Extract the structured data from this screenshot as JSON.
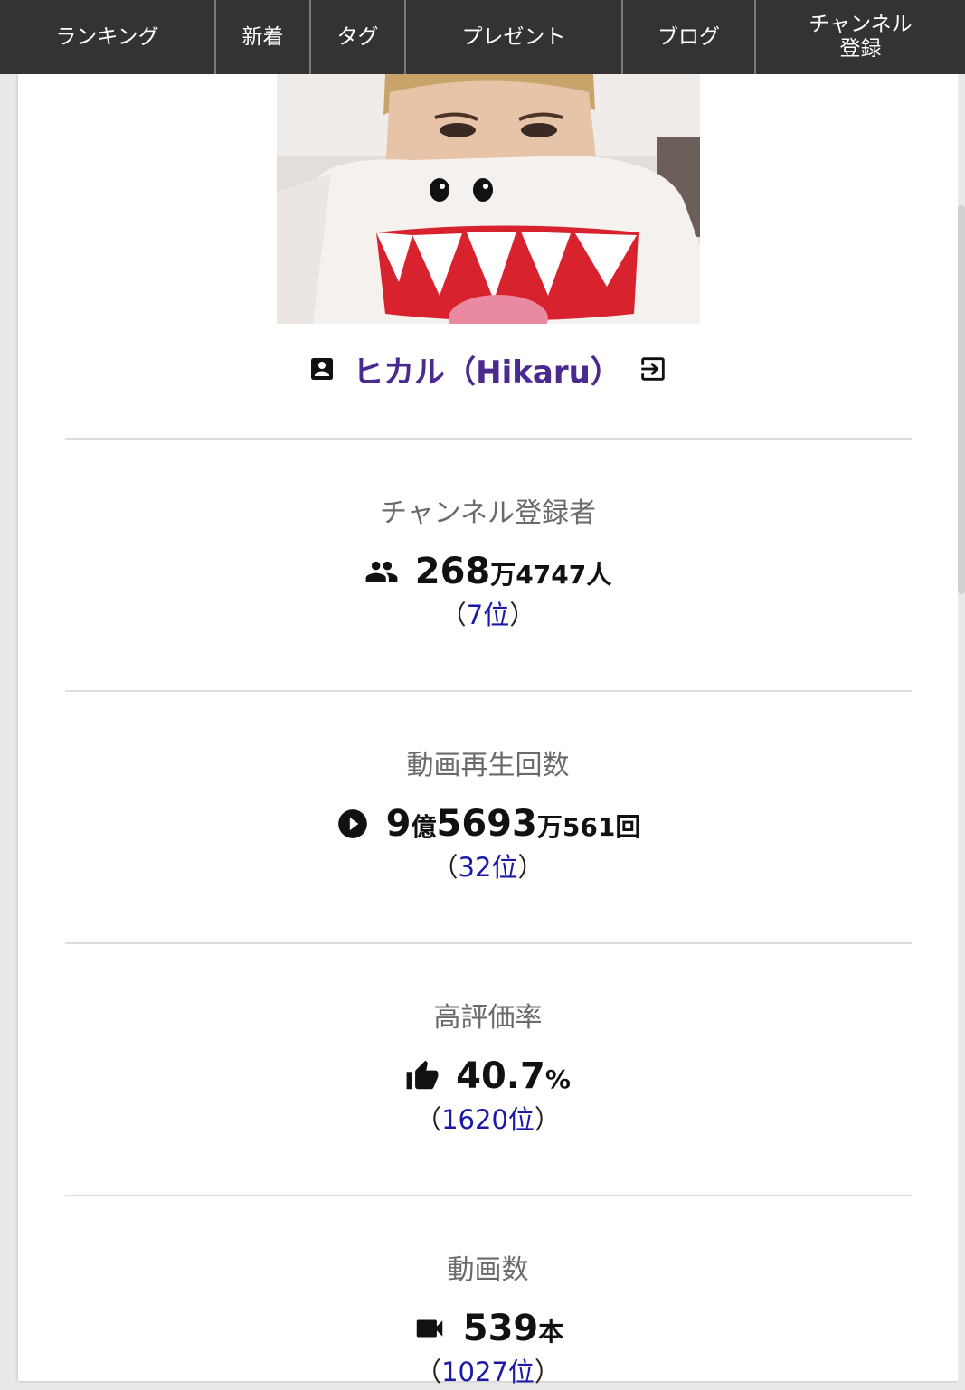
{
  "nav": {
    "items": [
      {
        "label": "ランキング"
      },
      {
        "label": "新着"
      },
      {
        "label": "タグ"
      },
      {
        "label": "プレゼント"
      },
      {
        "label": "ブログ"
      },
      {
        "label": "チャンネル\n登録"
      }
    ]
  },
  "channel": {
    "name": "ヒカル（Hikaru）",
    "icon_left": "account-box-icon",
    "icon_right": "exit-to-app-icon"
  },
  "stats": {
    "subscribers": {
      "label": "チャンネル登録者",
      "icon": "people-icon",
      "value_main": "268",
      "value_unit1": "万",
      "value_rest": "4747",
      "value_unit2": "人",
      "rank_open": "（",
      "rank": "7位",
      "rank_close": "）"
    },
    "views": {
      "label": "動画再生回数",
      "icon": "play-circle-icon",
      "v1": "9",
      "u1": "億",
      "v2": "5693",
      "u2": "万",
      "v3": "561",
      "u3": "回",
      "rank_open": "（",
      "rank": "32位",
      "rank_close": "）"
    },
    "rating": {
      "label": "高評価率",
      "icon": "thumb-up-icon",
      "value": "40.7",
      "unit": "%",
      "rank_open": "（",
      "rank": "1620位",
      "rank_close": "）"
    },
    "videos": {
      "label": "動画数",
      "icon": "videocam-icon",
      "value": "539",
      "unit": "本",
      "rank_open": "（",
      "rank": "1027位",
      "rank_close": "）"
    }
  },
  "colors": {
    "nav_bg": "#333333",
    "channel_link": "#4b2a8f",
    "rank_link": "#1a1aa6"
  }
}
